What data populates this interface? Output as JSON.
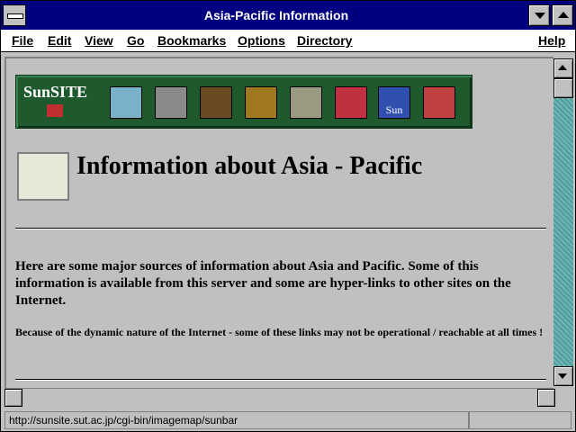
{
  "window": {
    "title": "Asia-Pacific Information"
  },
  "menu": [
    {
      "label": "File"
    },
    {
      "label": "Edit"
    },
    {
      "label": "View"
    },
    {
      "label": "Go"
    },
    {
      "label": "Bookmarks"
    },
    {
      "label": "Options"
    },
    {
      "label": "Directory"
    },
    {
      "label": "Help"
    }
  ],
  "banner": {
    "logo_text": "SunSITE",
    "sun_label": "Sun"
  },
  "page": {
    "heading": "Information about Asia - Pacific",
    "intro": "Here are some major sources of information about Asia and Pacific. Some of this information is available from this server and some are hyper-links to other sites on the Internet.",
    "note": "Because of the dynamic nature of the Internet - some of these links may not be operational / reachable at all times !"
  },
  "status": {
    "url": "http://sunsite.sut.ac.jp/cgi-bin/imagemap/sunbar"
  },
  "icons": [
    "map-icon",
    "computer-icon",
    "mona-lisa-icon",
    "flower-basket-icon",
    "building-icon",
    "tools-icon",
    "sun-logo-icon",
    "cube-icon"
  ]
}
